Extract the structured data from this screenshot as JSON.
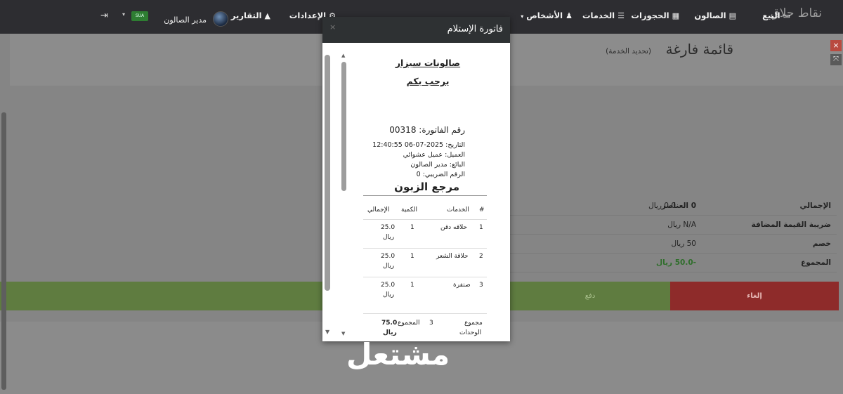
{
  "brand": "نقاط حلاق",
  "nav": {
    "sell": "البيع",
    "salon": "الصالون",
    "bookings": "الحجوزات",
    "services": "الخدمات",
    "people": "الأشخاص",
    "settings": "الإعدادات",
    "reports": "التقارير",
    "user": "مدير الصالون"
  },
  "page": {
    "title": "قائمة فارغة",
    "subtitle": "(تحديد الخدمة)"
  },
  "summary": {
    "total_label": "الإجمالي",
    "items_count": "0 العناصر",
    "items_value": "0.0 ريال",
    "vat_label": "ضريبة القيمة المضافة",
    "vat_value": "N/A ريال",
    "discount_label": "خصم",
    "discount_value": "50 ريال",
    "grand_label": "المجموع",
    "grand_value": "-50.0 ريال"
  },
  "buttons": {
    "pay": "دفع",
    "cancel": "إلغاء"
  },
  "modal": {
    "title": "فاتورة الإستلام",
    "close": "×"
  },
  "receipt": {
    "shop_name": "صالونات سيزار",
    "welcome": "يرحب بكم",
    "invoice_number": "رقم الفاتورة: 00318",
    "date": "التاريخ: 2025-07-06 12:40:55",
    "customer": "العميل: عميل عشوائي",
    "seller": "البائع: مدير الصالون",
    "tax_number": "الرقم الضريبي: 0",
    "customer_ref": "مرجع الزبون",
    "columns": {
      "num": "#",
      "service": "الخدمات",
      "qty": "الكمية",
      "total": "الإجمالي"
    },
    "rows": [
      {
        "num": "1",
        "service": "حلاقه دقن",
        "qty": "1",
        "total": "25.0",
        "currency": "ريال"
      },
      {
        "num": "2",
        "service": "حلاقة الشعر",
        "qty": "1",
        "total": "25.0",
        "currency": "ريال"
      },
      {
        "num": "3",
        "service": "صنفرة",
        "qty": "1",
        "total": "25.0",
        "currency": "ريال"
      }
    ],
    "units_label_1": "مجموع",
    "units_label_2": "الوحدات",
    "units_value": "3",
    "sum_label": "المجموع",
    "sum_value": "75.0",
    "sum_currency": "ريال"
  },
  "watermark": "مشتعل",
  "flag_text": "SUA"
}
